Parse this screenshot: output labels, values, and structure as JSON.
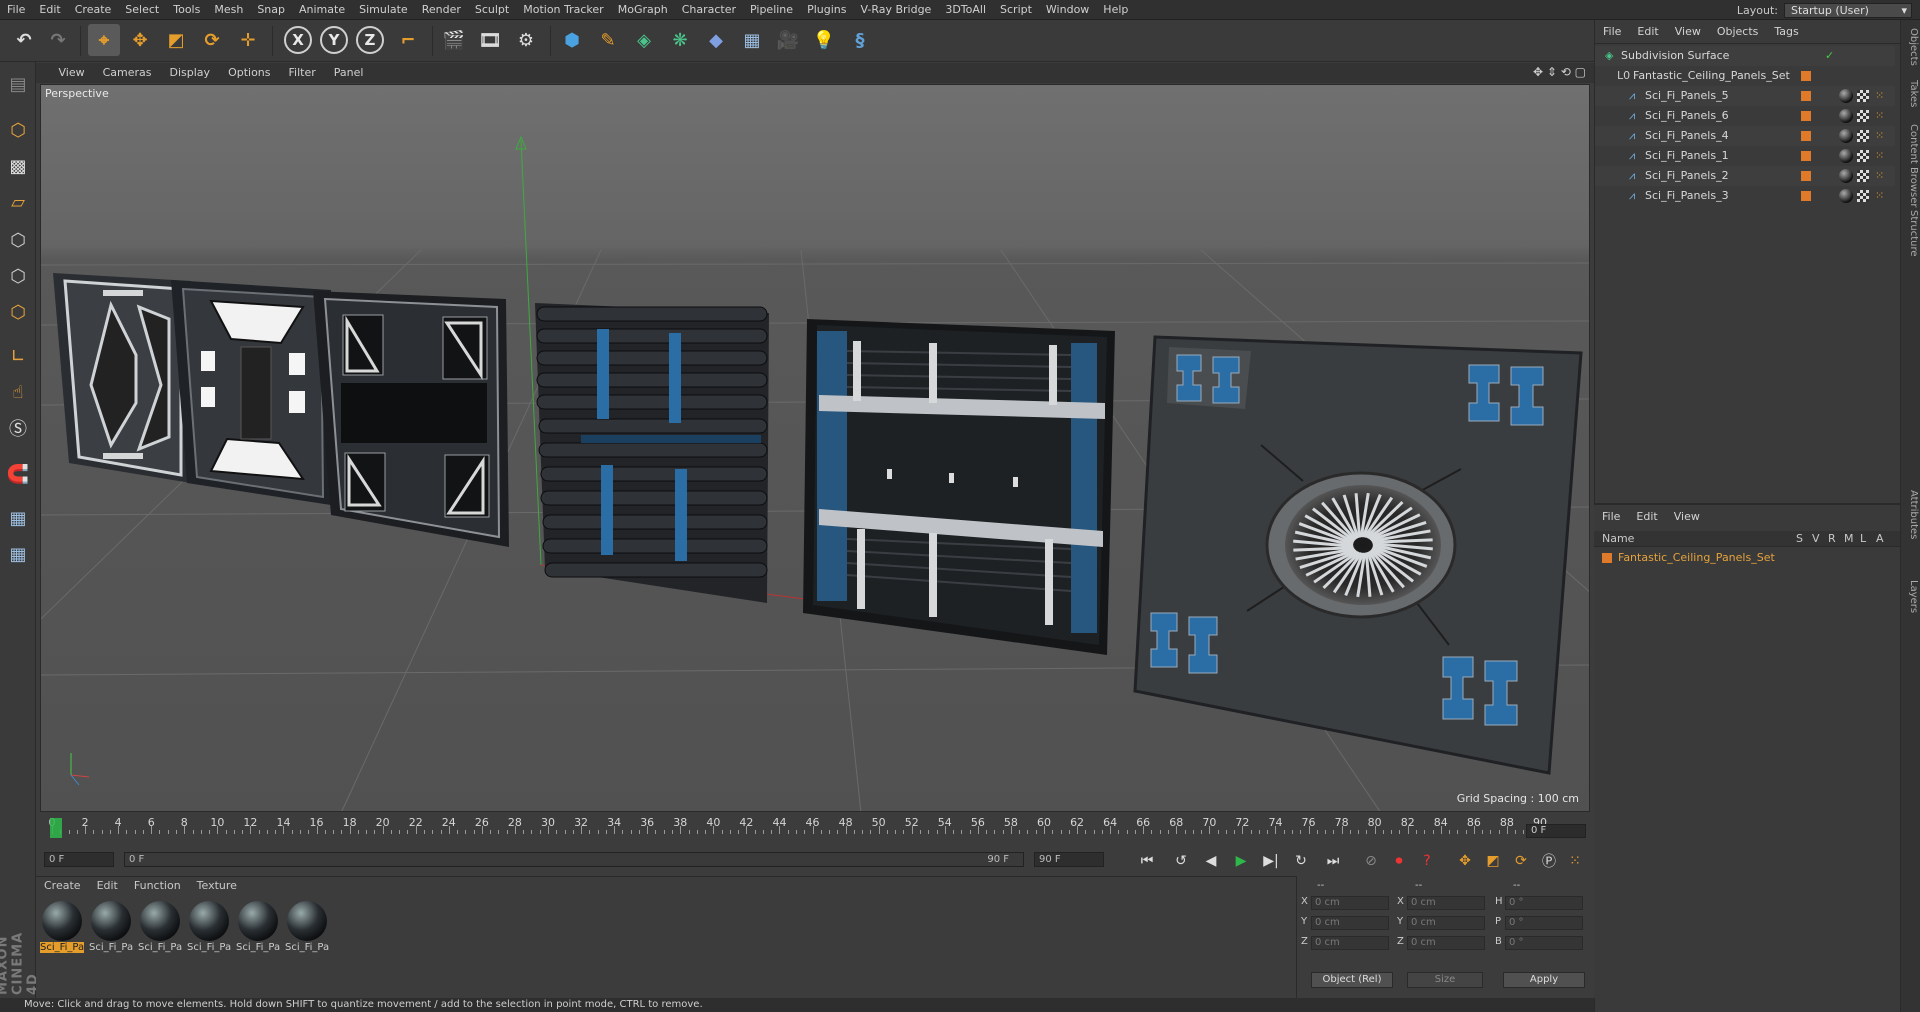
{
  "menubar": {
    "items": [
      "File",
      "Edit",
      "Create",
      "Select",
      "Tools",
      "Mesh",
      "Snap",
      "Animate",
      "Simulate",
      "Render",
      "Sculpt",
      "Motion Tracker",
      "MoGraph",
      "Character",
      "Pipeline",
      "Plugins",
      "V-Ray Bridge",
      "3DToAll",
      "Script",
      "Window",
      "Help"
    ],
    "layout_label": "Layout:",
    "layout_value": "Startup (User)"
  },
  "toolbar": {
    "axis_x": "X",
    "axis_y": "Y",
    "axis_z": "Z"
  },
  "viewport": {
    "menu": [
      "View",
      "Cameras",
      "Display",
      "Options",
      "Filter",
      "Panel"
    ],
    "view_name": "Perspective",
    "grid_spacing": "Grid Spacing : 100 cm"
  },
  "timeline": {
    "ticks": [
      "0",
      "2",
      "4",
      "6",
      "8",
      "10",
      "12",
      "14",
      "16",
      "18",
      "20",
      "22",
      "24",
      "26",
      "28",
      "30",
      "32",
      "34",
      "36",
      "38",
      "40",
      "42",
      "44",
      "46",
      "48",
      "50",
      "52",
      "54",
      "56",
      "58",
      "60",
      "62",
      "64",
      "66",
      "68",
      "70",
      "72",
      "74",
      "76",
      "78",
      "80",
      "82",
      "84",
      "86",
      "88",
      "90"
    ],
    "current_frame": "0 F",
    "start_field": "0 F",
    "slider_start": "0 F",
    "slider_end": "90 F",
    "end_field": "90 F"
  },
  "materials": {
    "menu": [
      "Create",
      "Edit",
      "Function",
      "Texture"
    ],
    "items": [
      "Sci_Fi_Pa",
      "Sci_Fi_Pa",
      "Sci_Fi_Pa",
      "Sci_Fi_Pa",
      "Sci_Fi_Pa",
      "Sci_Fi_Pa"
    ]
  },
  "coords": {
    "header": [
      "--",
      "--",
      "--"
    ],
    "rows": [
      {
        "a": "X",
        "av": "0 cm",
        "b": "X",
        "bv": "0 cm",
        "c": "H",
        "cv": "0 °"
      },
      {
        "a": "Y",
        "av": "0 cm",
        "b": "Y",
        "bv": "0 cm",
        "c": "P",
        "cv": "0 °"
      },
      {
        "a": "Z",
        "av": "0 cm",
        "b": "Z",
        "bv": "0 cm",
        "c": "B",
        "cv": "0 °"
      }
    ],
    "mode": "Object (Rel)",
    "size": "Size",
    "apply": "Apply"
  },
  "status": "Move: Click and drag to move elements. Hold down SHIFT to quantize movement / add to the selection in point mode, CTRL to remove.",
  "objects": {
    "menu": [
      "File",
      "Edit",
      "View",
      "Objects",
      "Tags"
    ],
    "rows": [
      {
        "name": "Subdivision Surface",
        "indent": 0
      },
      {
        "name": "Fantastic_Ceiling_Panels_Set",
        "indent": 1
      },
      {
        "name": "Sci_Fi_Panels_5",
        "indent": 2
      },
      {
        "name": "Sci_Fi_Panels_6",
        "indent": 2
      },
      {
        "name": "Sci_Fi_Panels_4",
        "indent": 2
      },
      {
        "name": "Sci_Fi_Panels_1",
        "indent": 2
      },
      {
        "name": "Sci_Fi_Panels_2",
        "indent": 2
      },
      {
        "name": "Sci_Fi_Panels_3",
        "indent": 2
      }
    ]
  },
  "layers": {
    "menu": [
      "File",
      "Edit",
      "View"
    ],
    "col_name": "Name",
    "cols": [
      "S",
      "V",
      "R",
      "M",
      "L",
      "A"
    ],
    "row": "Fantastic_Ceiling_Panels_Set"
  },
  "side_tabs": [
    "Objects",
    "Takes",
    "Content Browser",
    "Structure",
    "Attributes",
    "Layers"
  ],
  "brand": "MAXON CINEMA 4D",
  "colors": {
    "accent": "#e59d2b",
    "viewport_bg": "#5d5d5d",
    "panel_blue": "#2b6ea6"
  }
}
